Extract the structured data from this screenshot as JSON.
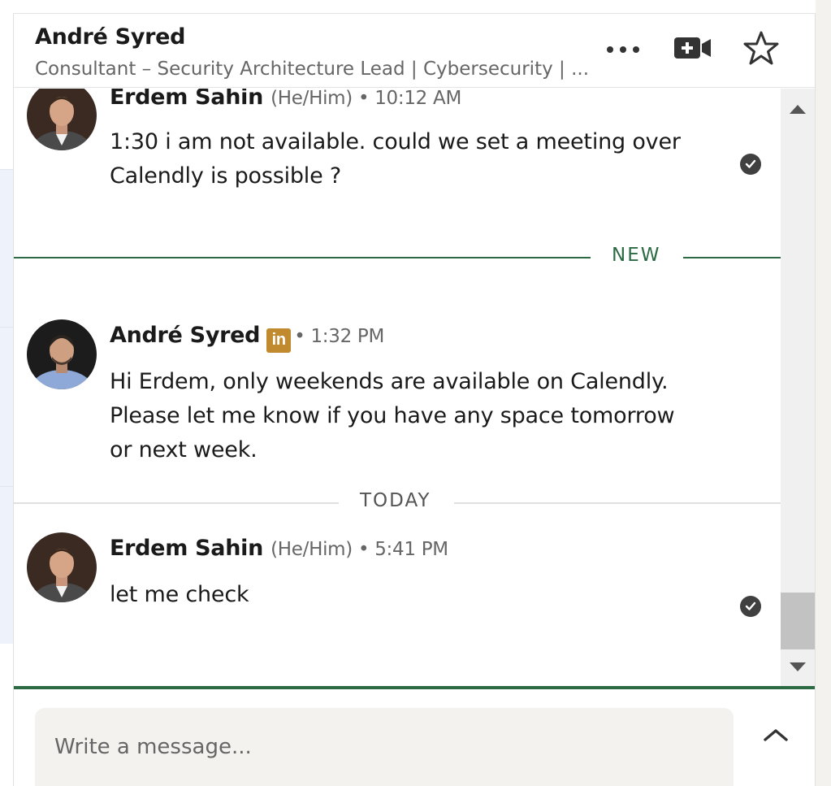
{
  "header": {
    "contact_name": "André Syred",
    "contact_headline": "Consultant – Security Architecture Lead | Cybersecurity | ..."
  },
  "icons": {
    "more": "more-icon",
    "video": "video-call-icon",
    "star": "star-icon",
    "read_receipt": "checkmark-icon",
    "linkedin_badge": "linkedin-icon",
    "expand": "chevron-up-icon"
  },
  "messages": [
    {
      "sender": "Erdem Sahin",
      "meta": "(He/Him) • 10:12 AM",
      "text": "1:30 i am not available. could we set a meeting over Calendly is possible ?",
      "read": true
    },
    {
      "sender": "André Syred",
      "badge": "in",
      "meta": "• 1:32 PM",
      "text": "Hi Erdem, only weekends are available on Calendly. Please let me know if you have any space tomorrow or next week.",
      "read": false
    },
    {
      "sender": "Erdem Sahin",
      "meta": "(He/Him) • 5:41 PM",
      "text": "let me check",
      "read": true
    }
  ],
  "dividers": {
    "new_label": "NEW",
    "today_label": "TODAY"
  },
  "composer": {
    "placeholder": "Write a message..."
  },
  "colors": {
    "accent_green": "#2b6a43",
    "linkedin_premium_gold": "#c28a2e"
  }
}
